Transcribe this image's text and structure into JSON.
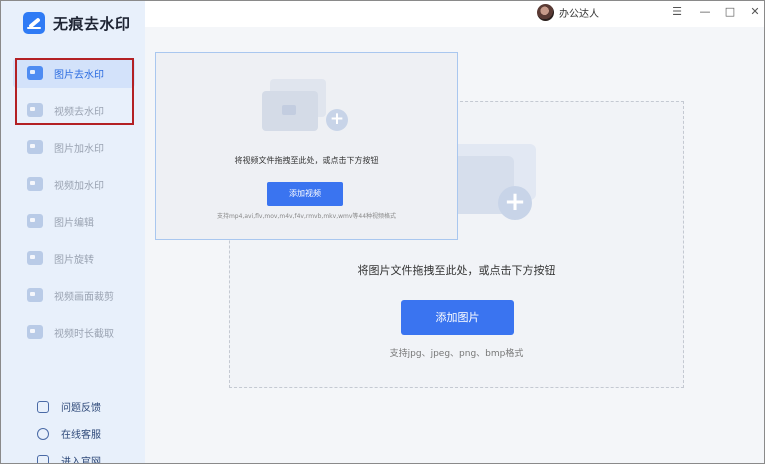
{
  "app": {
    "name": "无痕去水印",
    "logo_icon": "eraser-icon"
  },
  "user": {
    "name": "办公达人"
  },
  "window": {
    "menu": "☰",
    "minimize": "—",
    "maximize": "□",
    "close": "✕"
  },
  "sidebar": {
    "items": [
      {
        "label": "图片去水印",
        "icon": "image-icon",
        "active": true
      },
      {
        "label": "视频去水印",
        "icon": "video-icon"
      },
      {
        "label": "图片加水印",
        "icon": "image-add-icon"
      },
      {
        "label": "视频加水印",
        "icon": "video-add-icon"
      },
      {
        "label": "图片编辑",
        "icon": "image-edit-icon"
      },
      {
        "label": "图片旋转",
        "icon": "rotate-icon"
      },
      {
        "label": "视频画面裁剪",
        "icon": "crop-icon"
      },
      {
        "label": "视频时长截取",
        "icon": "trim-icon"
      }
    ],
    "bottom": [
      {
        "label": "问题反馈",
        "icon": "feedback-icon"
      },
      {
        "label": "在线客服",
        "icon": "service-icon"
      },
      {
        "label": "进入官网",
        "icon": "website-icon"
      }
    ]
  },
  "image_panel": {
    "hint": "将图片文件拖拽至此处，或点击下方按钮",
    "button": "添加图片",
    "formats": "支持jpg、jpeg、png、bmp格式"
  },
  "video_panel": {
    "hint": "将视频文件拖拽至此处，或点击下方按钮",
    "button": "添加视频",
    "formats": "支持mp4,avi,flv,mov,m4v,f4v,rmvb,mkv,wmv等44种视频格式"
  },
  "colors": {
    "accent": "#3a74f0",
    "sidebar_bg": "#e8f0fb",
    "highlight_box": "#b32024"
  }
}
